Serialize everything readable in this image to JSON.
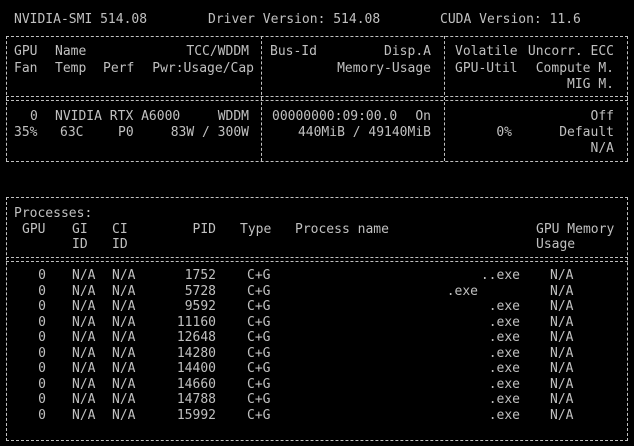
{
  "header": {
    "smi_version": "NVIDIA-SMI 514.08",
    "driver_version": "Driver Version: 514.08",
    "cuda_version": "CUDA Version: 11.6"
  },
  "gpu_table": {
    "headers": {
      "gpu": "GPU",
      "name": "Name",
      "tcc_wddm": "TCC/WDDM",
      "bus_id": "Bus-Id",
      "disp_a": "Disp.A",
      "volatile": "Volatile",
      "uncorr_ecc": "Uncorr. ECC",
      "fan": "Fan",
      "temp": "Temp",
      "perf": "Perf",
      "pwr_usage_cap": "Pwr:Usage/Cap",
      "memory_usage": "Memory-Usage",
      "gpu_util": "GPU-Util",
      "compute_m": "Compute M.",
      "mig_m": "MIG M."
    },
    "gpu": {
      "index": "0",
      "name": "NVIDIA RTX A6000",
      "mode": "WDDM",
      "bus_id": "00000000:09:00.0",
      "disp_a": "On",
      "ecc": "Off",
      "fan": "35%",
      "temp": "63C",
      "perf": "P0",
      "power": "83W / 300W",
      "memory": "440MiB / 49140MiB",
      "util": "0%",
      "compute_mode": "Default",
      "mig_mode": "N/A"
    }
  },
  "processes": {
    "title": "Processes:",
    "headers": {
      "gpu": "GPU",
      "gi": "GI",
      "gi2": "ID",
      "ci": "CI",
      "ci2": "ID",
      "pid": "PID",
      "type": "Type",
      "process_name": "Process name",
      "gpu_memory": "GPU Memory",
      "usage": "Usage"
    },
    "rows": [
      {
        "gpu": "0",
        "gi": "N/A",
        "ci": "N/A",
        "pid": "1752",
        "type": "C+G",
        "name": "..exe",
        "mem": "N/A"
      },
      {
        "gpu": "0",
        "gi": "N/A",
        "ci": "N/A",
        "pid": "5728",
        "type": "C+G",
        "name": ".exe",
        "mem": "N/A"
      },
      {
        "gpu": "0",
        "gi": "N/A",
        "ci": "N/A",
        "pid": "9592",
        "type": "C+G",
        "name": ".exe",
        "mem": "N/A"
      },
      {
        "gpu": "0",
        "gi": "N/A",
        "ci": "N/A",
        "pid": "11160",
        "type": "C+G",
        "name": ".exe",
        "mem": "N/A"
      },
      {
        "gpu": "0",
        "gi": "N/A",
        "ci": "N/A",
        "pid": "12648",
        "type": "C+G",
        "name": ".exe",
        "mem": "N/A"
      },
      {
        "gpu": "0",
        "gi": "N/A",
        "ci": "N/A",
        "pid": "14280",
        "type": "C+G",
        "name": ".exe",
        "mem": "N/A"
      },
      {
        "gpu": "0",
        "gi": "N/A",
        "ci": "N/A",
        "pid": "14400",
        "type": "C+G",
        "name": ".exe",
        "mem": "N/A"
      },
      {
        "gpu": "0",
        "gi": "N/A",
        "ci": "N/A",
        "pid": "14660",
        "type": "C+G",
        "name": ".exe",
        "mem": "N/A"
      },
      {
        "gpu": "0",
        "gi": "N/A",
        "ci": "N/A",
        "pid": "14788",
        "type": "C+G",
        "name": ".exe",
        "mem": "N/A"
      },
      {
        "gpu": "0",
        "gi": "N/A",
        "ci": "N/A",
        "pid": "15992",
        "type": "C+G",
        "name": ".exe",
        "mem": "N/A"
      }
    ]
  },
  "colors": {
    "background": "#000000",
    "foreground": "#c0c0c0"
  }
}
